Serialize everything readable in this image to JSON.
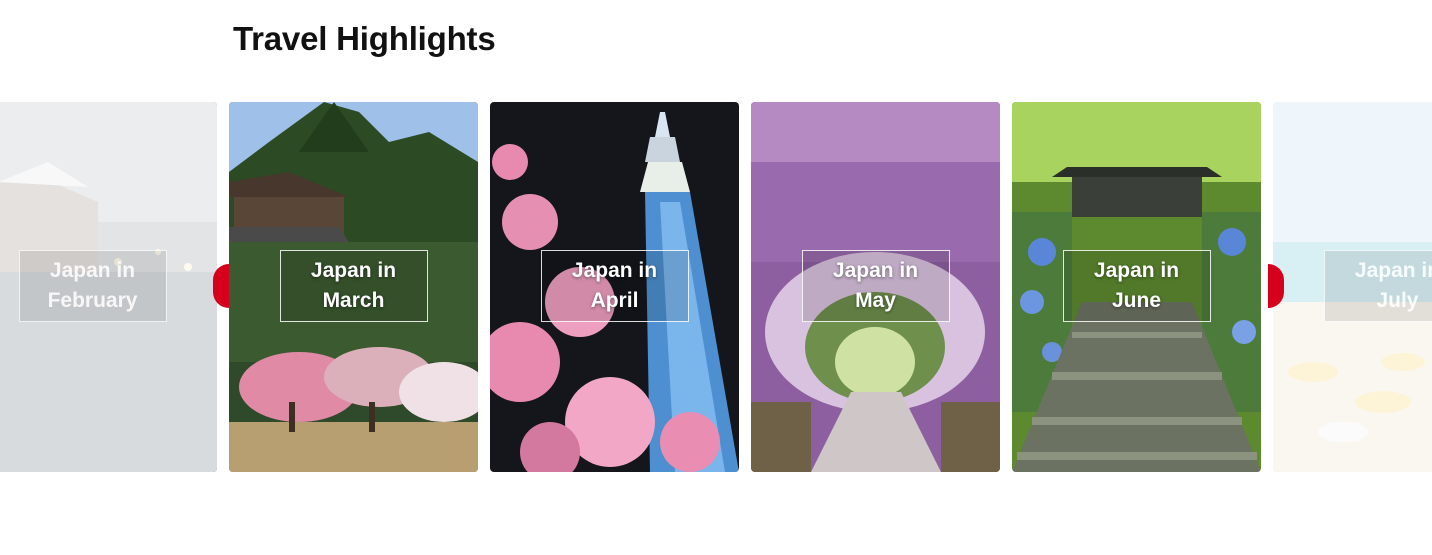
{
  "section": {
    "title": "Travel Highlights"
  },
  "cards": [
    {
      "label": "Japan in February",
      "line1": "Japan in",
      "line2": "February",
      "scene": "snowy canal night"
    },
    {
      "label": "Japan in March",
      "line1": "Japan in",
      "line2": "March",
      "scene": "plum blossom garden"
    },
    {
      "label": "Japan in April",
      "line1": "Japan in",
      "line2": "April",
      "scene": "cherry blossoms and tower"
    },
    {
      "label": "Japan in May",
      "line1": "Japan in",
      "line2": "May",
      "scene": "wisteria tunnel"
    },
    {
      "label": "Japan in June",
      "line1": "Japan in",
      "line2": "June",
      "scene": "hydrangea temple steps"
    },
    {
      "label": "Japan in July",
      "line1": "Japan in",
      "line2": "July",
      "scene": "beach with umbrellas"
    }
  ],
  "controls": {
    "prev_icon": "chevron-left-icon",
    "next_icon": "chevron-right-icon",
    "accent": "#d6001c"
  }
}
